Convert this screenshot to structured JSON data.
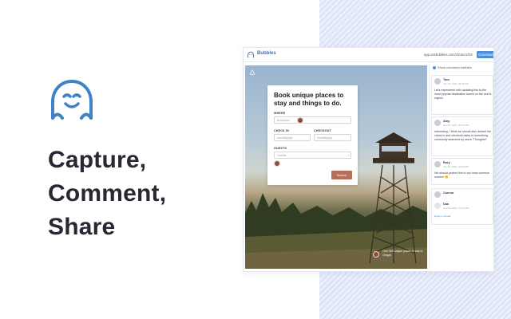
{
  "brand": {
    "logo_icon": "ghost-icon",
    "accent_color": "#3f83c7",
    "headline": [
      "Capture,",
      "Comment,",
      "Share"
    ]
  },
  "window": {
    "app_name": "Bubbles",
    "url": "app.usebubbles.com/1fa3e21f19",
    "download_label": "Download",
    "menu_icon": "more-vertical-icon"
  },
  "screenshot": {
    "card_title": "Book unique places to stay and things to do.",
    "where_label": "WHERE",
    "where_placeholder": "Anywhere",
    "checkin_label": "CHECK IN",
    "checkin_placeholder": "mm/dd/yyyy",
    "checkout_label": "CHECKOUT",
    "checkout_placeholder": "mm/dd/yyyy",
    "guests_label": "GUESTS",
    "guests_placeholder": "Guests",
    "search_label": "Search",
    "caption": "Over 500 unique places to stay in Oregon"
  },
  "comments_panel": {
    "show_comments_label": "Show comment bubbles",
    "comments": [
      {
        "author": "Tom",
        "time": "Jun 09, 2021, 09:45 PM",
        "text": "Let's experiment with updating this to the most popular destination based on the user's region!"
      },
      {
        "author": "Amy",
        "time": "Jun 09, 2021, 09:57 PM",
        "text": "Interesting, I think we should also default the check in and checkout dates to something commonly searched by users. Thoughts?"
      },
      {
        "author": "Rory",
        "time": "Jun 09, 2021, 10:09 PM",
        "text": "We should protect this to our most common number 🙂"
      }
    ],
    "reply_author": "Connor",
    "reply_user": "Dan",
    "reply_time": "Jun 09, 2021, 10:14 PM",
    "reply_link": "Reply to thread"
  }
}
